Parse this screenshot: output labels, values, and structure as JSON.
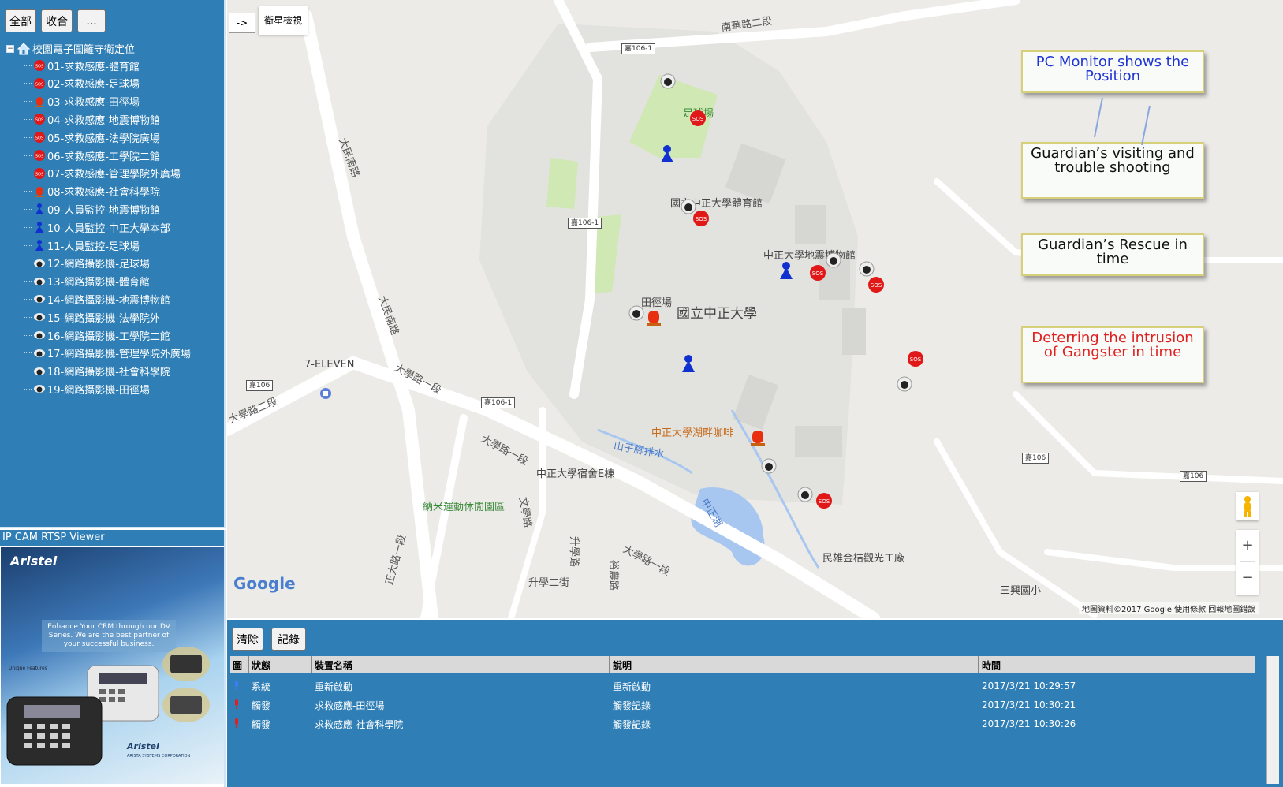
{
  "toolbar": {
    "all_label": "全部",
    "collapse_label": "收合",
    "more_label": "..."
  },
  "tree": {
    "root_label": "校園電子圍籬守衛定位",
    "items": [
      {
        "label": "01-求救感應-體育館",
        "icon": "sos-icon"
      },
      {
        "label": "02-求救感應-足球場",
        "icon": "sos-icon"
      },
      {
        "label": "03-求救感應-田徑場",
        "icon": "alarm-light-icon"
      },
      {
        "label": "04-求救感應-地震博物館",
        "icon": "sos-icon"
      },
      {
        "label": "05-求救感應-法學院廣場",
        "icon": "sos-icon"
      },
      {
        "label": "06-求救感應-工學院二館",
        "icon": "sos-icon"
      },
      {
        "label": "07-求救感應-管理學院外廣場",
        "icon": "sos-icon"
      },
      {
        "label": "08-求救感應-社會科學院",
        "icon": "alarm-light-icon"
      },
      {
        "label": "09-人員監控-地震博物館",
        "icon": "guard-icon"
      },
      {
        "label": "10-人員監控-中正大學本部",
        "icon": "guard-icon"
      },
      {
        "label": "11-人員監控-足球場",
        "icon": "guard-icon"
      },
      {
        "label": "12-網路攝影機-足球場",
        "icon": "camera-icon"
      },
      {
        "label": "13-網路攝影機-體育館",
        "icon": "camera-icon"
      },
      {
        "label": "14-網路攝影機-地震博物館",
        "icon": "camera-icon"
      },
      {
        "label": "15-網路攝影機-法學院外",
        "icon": "camera-icon"
      },
      {
        "label": "16-網路攝影機-工學院二館",
        "icon": "camera-icon"
      },
      {
        "label": "17-網路攝影機-管理學院外廣場",
        "icon": "camera-icon"
      },
      {
        "label": "18-網路攝影機-社會科學院",
        "icon": "camera-icon"
      },
      {
        "label": "19-網路攝影機-田徑場",
        "icon": "camera-icon"
      }
    ]
  },
  "viewer": {
    "title": "IP CAM RTSP Viewer",
    "brand": "Aristel",
    "slogan": "Enhance Your CRM through our DV Series. We are the best partner of your successful business.",
    "features_title": "Unique Features",
    "foot_brand": "Aristel",
    "foot_corp": "ARISTA SYSTEMS CORPORATION"
  },
  "map": {
    "toggle_label": "->",
    "type_label": "衛星檢視",
    "google_logo": "Google",
    "attribution": "地圖資料©2017 Google   使用條款   回報地圖錯誤",
    "zoom_in": "+",
    "zoom_out": "−",
    "labels": {
      "university": "國立中正大學",
      "football_field": "足球場",
      "gym": "國立中正大學體育館",
      "museum": "中正大學地震博物館",
      "track": "田徑場",
      "seven_eleven": "7-ELEVEN",
      "cafe": "中正大學湖畔咖啡",
      "stream": "山子腳排水",
      "dorm": "中正大學宿舍E棟",
      "park": "納米運動休閒園區",
      "lake": "中正湖",
      "factory": "民雄金桔觀光工廠",
      "school": "三興國小",
      "road_nanhua": "南華路二段",
      "road_damin": "大民南路",
      "road_damin2": "大民南路",
      "road_daxue": "大學路一段",
      "road_daxue2": "大學路一段",
      "road_daxue3": "大學路二段",
      "road_daxue4": "大學路一段",
      "road_wenxue": "文學路",
      "road_shengxue": "升學路",
      "road_shengxue2": "升學二街",
      "road_zhengda": "正大路一段",
      "road_yuxiu": "裕農路"
    },
    "shields": [
      "嘉106-1",
      "嘉106-1",
      "嘉106",
      "嘉106-1",
      "嘉106",
      "嘉106"
    ],
    "info_boxes": [
      {
        "text": "PC Monitor shows the Position",
        "color": "#1f33d6"
      },
      {
        "text": "Guardian’s visiting and trouble shooting",
        "color": "#111111"
      },
      {
        "text": "Guardian’s Rescue in time",
        "color": "#111111"
      },
      {
        "text": "Deterring the intrusion of Gangster in time",
        "color": "#e02020"
      }
    ]
  },
  "log": {
    "clear_label": "清除",
    "record_label": "記錄",
    "columns": [
      "圖",
      "狀態",
      "裝置名稱",
      "說明",
      "時間"
    ],
    "rows": [
      {
        "status": "系統",
        "device": "重新啟動",
        "desc": "重新啟動",
        "time": "2017/3/21 10:29:57",
        "icon_color": "#3c7bff"
      },
      {
        "status": "觸發",
        "device": "求救感應-田徑場",
        "desc": "觸發記錄",
        "time": "2017/3/21 10:30:21",
        "icon_color": "#e02020"
      },
      {
        "status": "觸發",
        "device": "求救感應-社會科學院",
        "desc": "觸發記錄",
        "time": "2017/3/21 10:30:26",
        "icon_color": "#e02020"
      }
    ]
  }
}
